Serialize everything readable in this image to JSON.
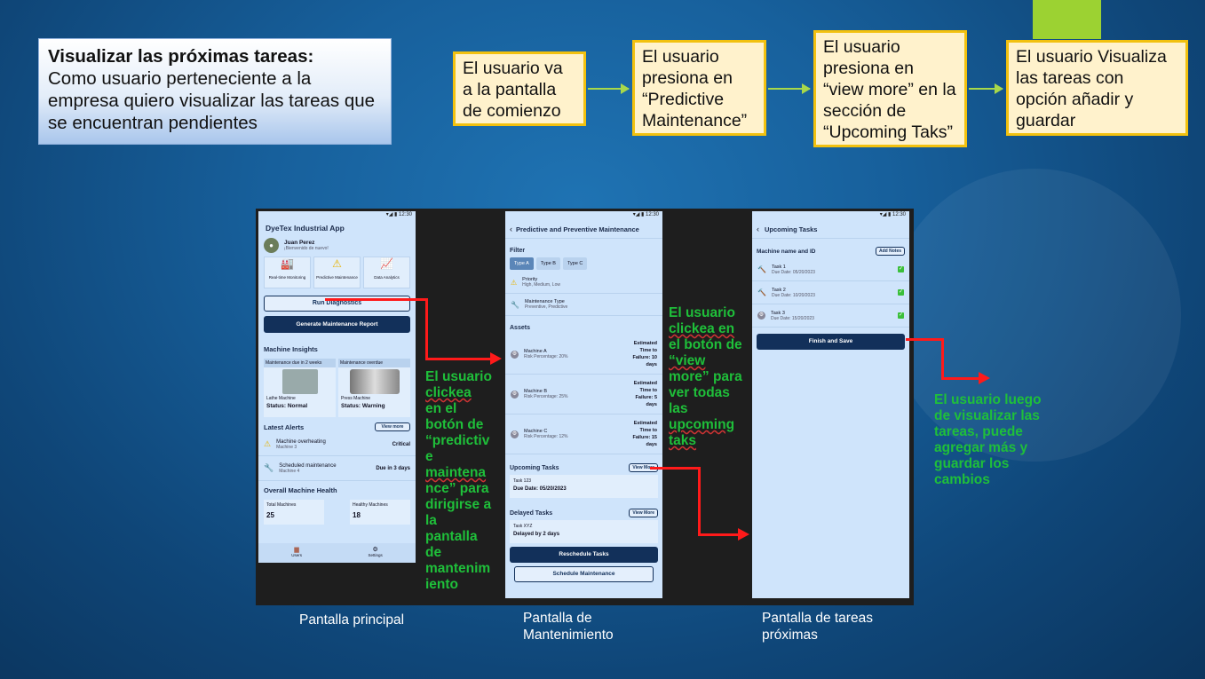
{
  "story": {
    "title": "Visualizar las próximas tareas:",
    "body": "Como usuario perteneciente a la empresa quiero visualizar las tareas que se encuentran pendientes"
  },
  "steps": [
    "El usuario va a la pantalla de comienzo",
    "El usuario presiona en “Predictive Maintenance”",
    "El usuario presiona en “view more” en la sección de “Upcoming Taks”",
    "El usuario Visualiza las tareas con opción añadir y guardar"
  ],
  "annotations": {
    "a1": [
      "El usuario",
      "clickea",
      "en el",
      "botón de",
      "“predictiv",
      "e",
      "maintena",
      "nce” para",
      "dirigirse a",
      "la",
      "pantalla",
      "de",
      "mantenim",
      "iento"
    ],
    "a2": [
      "El usuario",
      "clickea en",
      "el botón de",
      "“view",
      "more” para",
      "ver todas",
      "las",
      "upcoming",
      "taks"
    ],
    "a3": [
      "El usuario luego",
      "de visualizar las",
      "tareas, puede",
      "agregar más y",
      "guardar los",
      "cambios"
    ]
  },
  "labels": {
    "p1": "Pantalla principal",
    "p2a": "Pantalla de",
    "p2b": "Mantenimiento",
    "p3a": "Pantalla de tareas",
    "p3b": "próximas"
  },
  "phone1": {
    "time": "12:30",
    "app_title": "DyeTex Industrial App",
    "user_name": "Juan Perez",
    "user_greeting": "¡Bienvenido de nuevo!",
    "tiles": [
      "Real-time Monitoring",
      "Predictive Maintenance",
      "Data Analytics"
    ],
    "run_diag": "Run Diagnostics",
    "gen_report": "Generate Maintenance Report",
    "insights_title": "Machine Insights",
    "insight_cards": [
      {
        "head": "Maintenance due in 2 weeks",
        "name": "Lathe Machine",
        "status": "Status: Normal"
      },
      {
        "head": "Maintenance overdue",
        "name": "Press Machine",
        "status": "Status: Warning"
      }
    ],
    "alerts_title": "Latest Alerts",
    "view_more": "View more",
    "alerts": [
      {
        "title": "Machine overheating",
        "sub": "Machine 3",
        "right": "Critical"
      },
      {
        "title": "Scheduled maintenance",
        "sub": "Machine 4",
        "right": "Due in 3 days"
      }
    ],
    "health_title": "Overall Machine Health",
    "health": [
      {
        "label": "Total Machines",
        "value": "25"
      },
      {
        "label": "Healthy Machines",
        "value": "18"
      }
    ],
    "nav": [
      "Users",
      "Settings"
    ]
  },
  "phone2": {
    "time": "12:30",
    "title": "Predictive and Preventive Maintenance",
    "filter": "Filter",
    "types": [
      "Type A",
      "Type B",
      "Type C"
    ],
    "priority": {
      "title": "Priority",
      "sub": "High, Medium, Low"
    },
    "mtype": {
      "title": "Maintenance Type",
      "sub": "Preventive, Predictive"
    },
    "assets_title": "Assets",
    "assets": [
      {
        "name": "Machine A",
        "risk": "Risk Percentage: 20%",
        "est": [
          "Estimated",
          "Time to",
          "Failure: 10",
          "days"
        ]
      },
      {
        "name": "Machine B",
        "risk": "Risk Percentage: 25%",
        "est": [
          "Estimated",
          "Time to",
          "Failure: 5",
          "days"
        ]
      },
      {
        "name": "Machine C",
        "risk": "Risk Percentage: 12%",
        "est": [
          "Estimated",
          "Time to",
          "Failure: 15",
          "days"
        ]
      }
    ],
    "upcoming_title": "Upcoming Tasks",
    "view_more": "View More",
    "upcoming_task": {
      "name": "Task 123",
      "due": "Due Date: 05/20/2023"
    },
    "delayed_title": "Delayed Tasks",
    "delayed_task": {
      "name": "Task XYZ",
      "due": "Delayed by 2 days"
    },
    "reschedule": "Reschedule Tasks",
    "schedule": "Schedule Maintenance"
  },
  "phone3": {
    "time": "12:30",
    "title": "Upcoming Tasks",
    "machine": "Machine name and ID",
    "add_notes": "Add Notes",
    "tasks": [
      {
        "name": "Task 1",
        "due": "Due Date: 05/20/2023"
      },
      {
        "name": "Task 2",
        "due": "Due Date: 10/20/2023"
      },
      {
        "name": "Task 3",
        "due": "Due Date: 15/20/2023"
      }
    ],
    "finish": "Finish and Save"
  },
  "colors": {
    "accent_green": "#1fbf3a",
    "arrow_red": "#ff1a1a",
    "step_fill": "#fff2cc",
    "step_border": "#f2c10f",
    "navy": "#12305a"
  }
}
